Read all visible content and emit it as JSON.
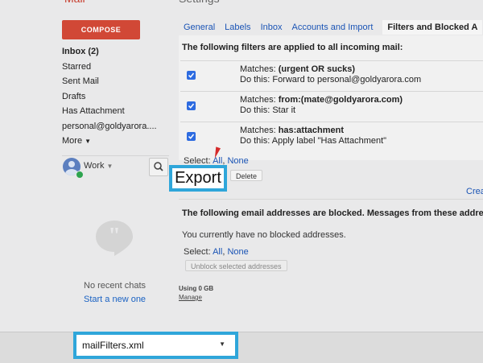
{
  "sidebar": {
    "compose_label": "COMPOSE",
    "items": [
      {
        "label": "Inbox (2)",
        "bold": true
      },
      {
        "label": "Starred"
      },
      {
        "label": "Sent Mail"
      },
      {
        "label": "Drafts"
      },
      {
        "label": "Has Attachment"
      },
      {
        "label": "personal@goldyarora...."
      },
      {
        "label": "More"
      }
    ],
    "chat_user": "Work",
    "no_chats": "No recent chats",
    "start_chat": "Start a new one"
  },
  "tabs": [
    {
      "label": "General"
    },
    {
      "label": "Labels"
    },
    {
      "label": "Inbox"
    },
    {
      "label": "Accounts and Import"
    },
    {
      "label": "Filters and Blocked A"
    }
  ],
  "filters": {
    "heading": "The following filters are applied to all incoming mail:",
    "rows": [
      {
        "matches_prefix": "Matches: ",
        "matches_value": "(urgent OR sucks)",
        "action": "Do this: Forward to personal@goldyarora.com"
      },
      {
        "matches_prefix": "Matches: ",
        "matches_value": "from:(mate@goldyarora.com)",
        "action": "Do this: Star it"
      },
      {
        "matches_prefix": "Matches: ",
        "matches_value": "has:attachment",
        "action": "Do this: Apply label \"Has Attachment\""
      }
    ],
    "select_label": "Select: ",
    "select_all": "All",
    "select_none": "None",
    "delete_label": "Delete",
    "create_label": "Crea"
  },
  "blocked": {
    "heading": "The following email addresses are blocked. Messages from these address",
    "empty_text": "You currently have no blocked addresses.",
    "select_label": "Select: ",
    "select_all": "All",
    "select_none": "None",
    "unblock_label": "Unblock selected addresses"
  },
  "storage": {
    "usage": "Using 0 GB",
    "manage": "Manage"
  },
  "callout": {
    "export_label": "Export"
  },
  "download": {
    "filename": "mailFilters.xml"
  },
  "colors": {
    "compose": "#d14836",
    "link": "#1a54b5",
    "highlight": "#2fa6da",
    "checkbox": "#2d6be0"
  }
}
